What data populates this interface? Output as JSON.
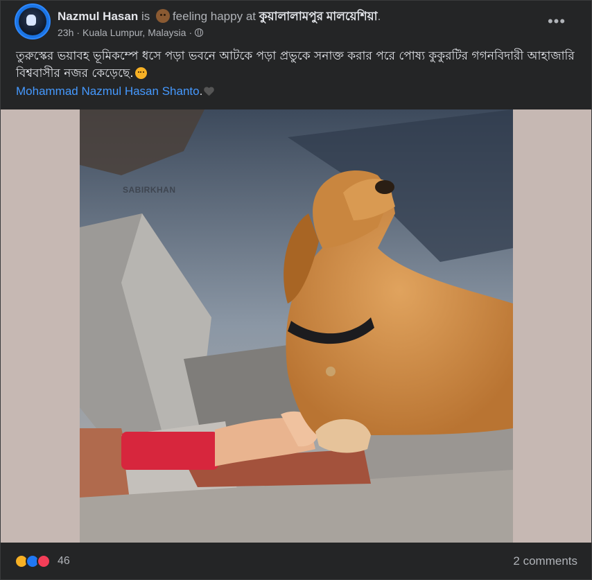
{
  "post": {
    "author": "Nazmul Hasan",
    "is_word": "is",
    "feeling_text": "feeling happy at",
    "location": "কুয়ালালামপুর মালয়েশিয়া",
    "location_period": ".",
    "time": "23h",
    "place": "Kuala Lumpur, Malaysia",
    "separator": "·",
    "more_label": "•••",
    "text": "তুরুস্কের ভয়াবহ ভূমিকম্পে ধসে পড়া ভবনে আটকে পড়া প্রভুকে সনাক্ত করার পরে পোষ্য কুকুরটির গগনবিদারী আহাজারি বিশ্ববাসীর নজর কেড়েছে.",
    "mention": "Mohammad Nazmul Hasan Shanto",
    "mention_suffix": ".",
    "photo_watermark": "SABIRKHAN"
  },
  "footer": {
    "reaction_count": "46",
    "comments_label": "2 comments"
  },
  "colors": {
    "background": "#242526",
    "text": "#e4e6eb",
    "muted": "#b0b3b8",
    "link": "#4599ff",
    "media_bg": "#c6b8b3"
  },
  "icons": [
    "globe-icon",
    "more-icon",
    "sad-reaction-icon",
    "like-reaction-icon",
    "love-reaction-icon"
  ]
}
